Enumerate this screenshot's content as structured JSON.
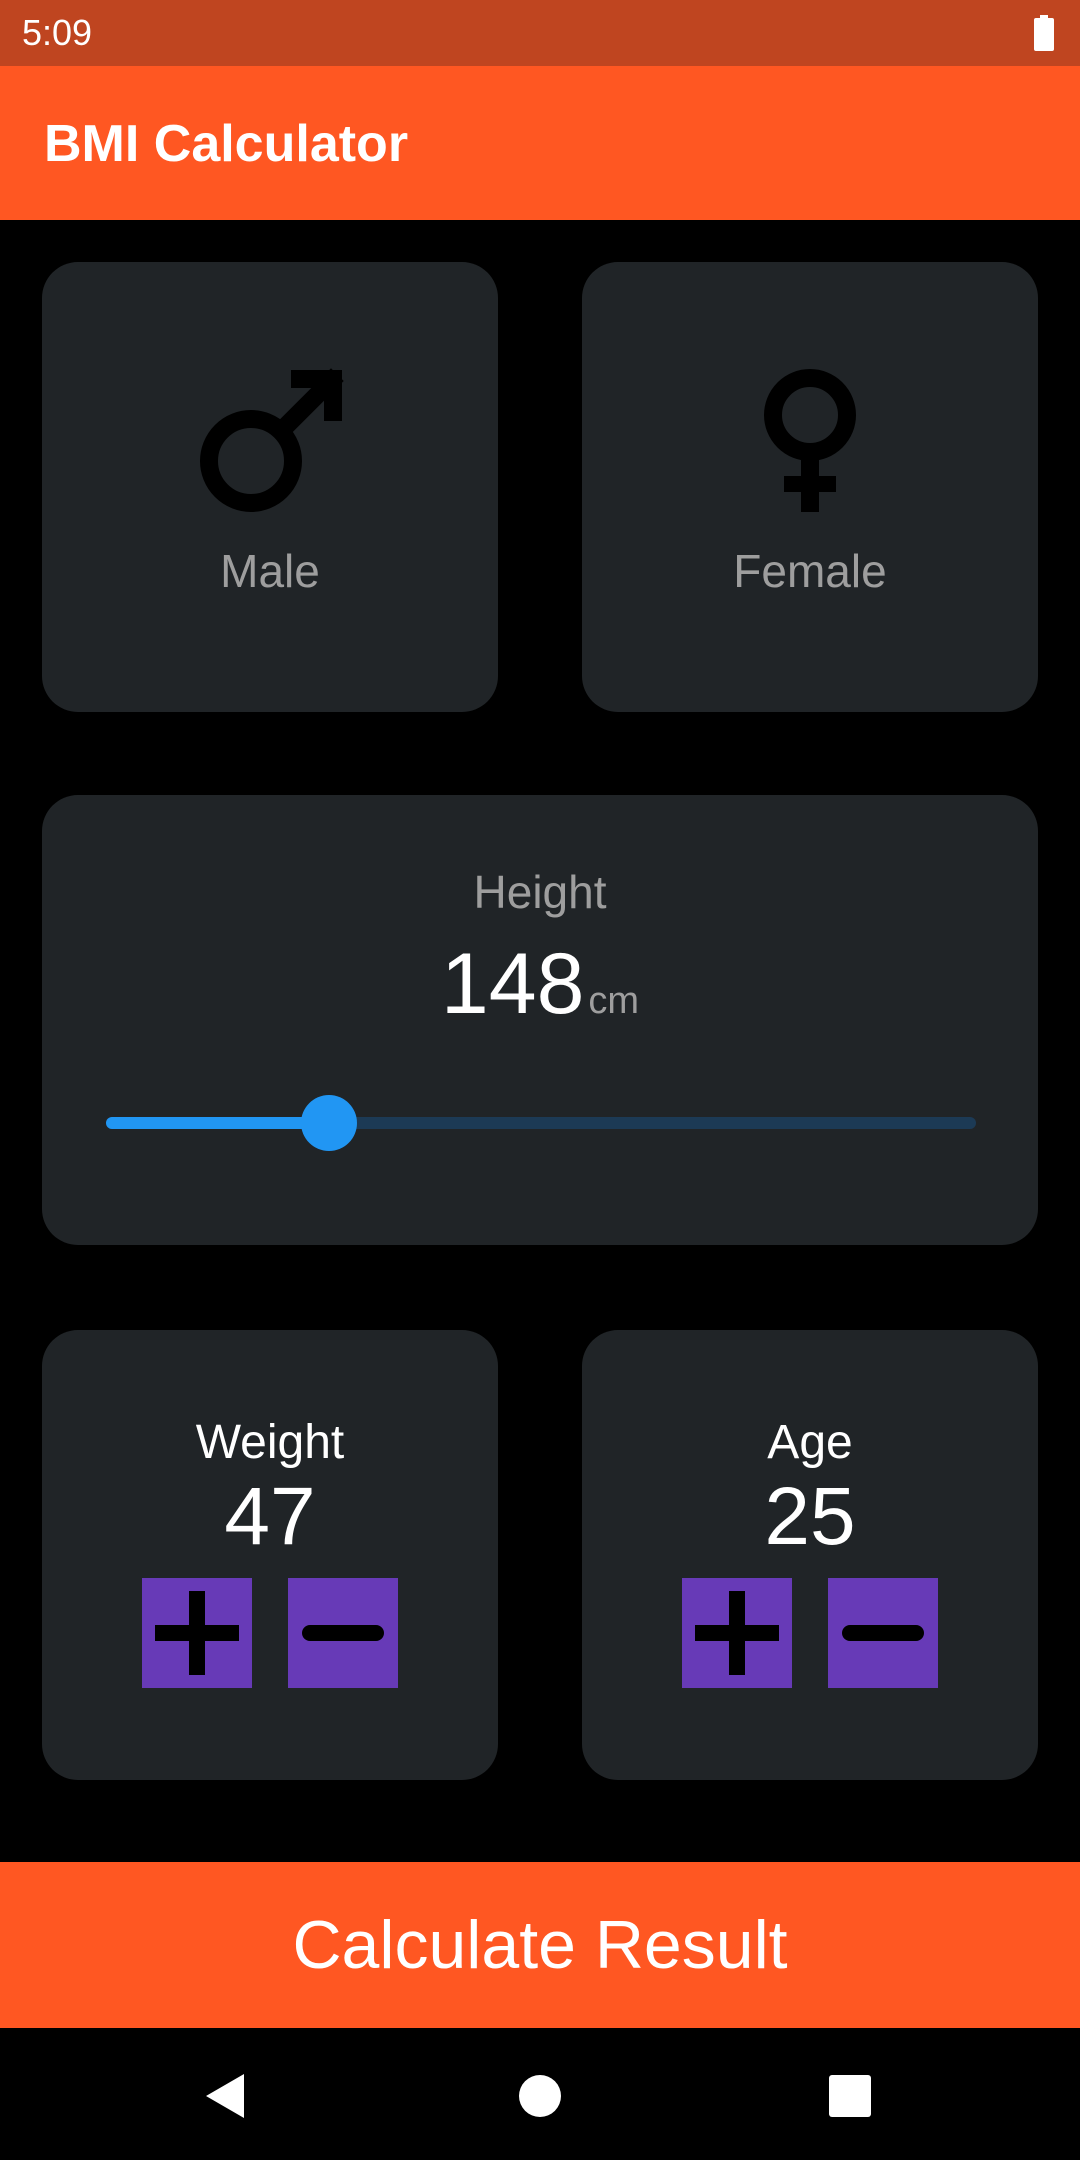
{
  "status_bar": {
    "time": "5:09",
    "battery_icon": "battery-full-icon"
  },
  "app_bar": {
    "title": "BMI Calculator",
    "color": "#ff5722"
  },
  "gender": {
    "male": {
      "label": "Male",
      "icon": "male-symbol-icon"
    },
    "female": {
      "label": "Female",
      "icon": "female-symbol-icon"
    }
  },
  "height": {
    "title": "Height",
    "value": "148",
    "unit": "cm",
    "slider_fraction": 0.256,
    "slider_color": "#2196f3"
  },
  "weight": {
    "label": "Weight",
    "value": "47",
    "plus_icon": "plus-icon",
    "minus_icon": "minus-icon"
  },
  "age": {
    "label": "Age",
    "value": "25",
    "plus_icon": "plus-icon",
    "minus_icon": "minus-icon"
  },
  "counter_button_color": "#673ab7",
  "card_color": "#202427",
  "calculate_button": {
    "label": "Calculate Result"
  },
  "nav_bar": {
    "back": "back-icon",
    "home": "home-icon",
    "recents": "recents-icon"
  }
}
